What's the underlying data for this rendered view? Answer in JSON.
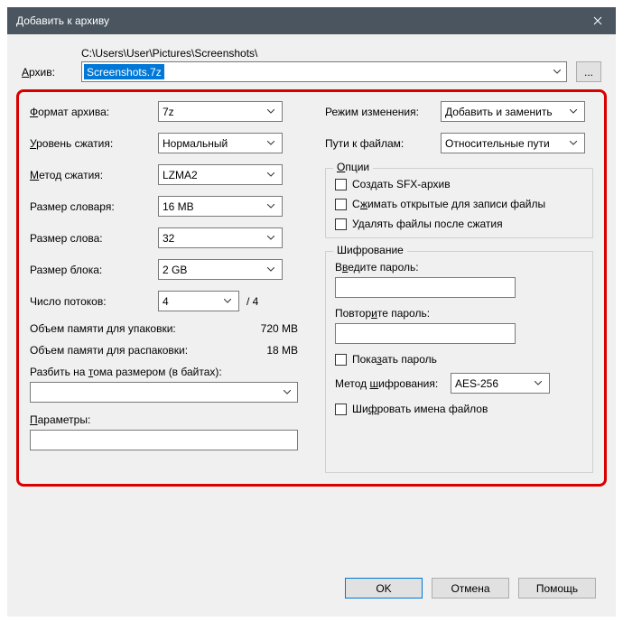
{
  "title": "Добавить к архиву",
  "archive": {
    "label": "Архив:",
    "path": "C:\\Users\\User\\Pictures\\Screenshots\\",
    "filename": "Screenshots.7z",
    "browse": "..."
  },
  "left": {
    "format": {
      "label": "Формат архива:",
      "accel": "Ф",
      "value": "7z"
    },
    "level": {
      "label": "Уровень сжатия:",
      "accel": "У",
      "value": "Нормальный"
    },
    "method": {
      "label": "Метод сжатия:",
      "accel": "М",
      "value": "LZMA2"
    },
    "dict": {
      "label": "Размер словаря:",
      "value": "16 MB"
    },
    "word": {
      "label": "Размер слова:",
      "value": "32"
    },
    "block": {
      "label": "Размер блока:",
      "value": "2 GB"
    },
    "threads": {
      "label": "Число потоков:",
      "value": "4",
      "max": "/ 4"
    },
    "mem_pack": {
      "label": "Объем памяти для упаковки:",
      "value": "720 MB"
    },
    "mem_unpack": {
      "label": "Объем памяти для распаковки:",
      "value": "18 MB"
    },
    "split": {
      "label": "Разбить на тома размером (в байтах):"
    },
    "params": {
      "label": "Параметры:"
    }
  },
  "right": {
    "mode": {
      "label": "Режим изменения:",
      "value": "Добавить и заменить"
    },
    "paths": {
      "label": "Пути к файлам:",
      "value": "Относительные пути"
    },
    "options": {
      "legend": "Опции",
      "sfx": "Создать SFX-архив",
      "shared": "Сжимать открытые для записи файлы",
      "delete": "Удалять файлы после сжатия"
    },
    "enc": {
      "legend": "Шифрование",
      "pwd": "Введите пароль:",
      "pwd2": "Повторите пароль:",
      "show": "Показать пароль",
      "method_label": "Метод шифрования:",
      "method_value": "AES-256",
      "names": "Шифровать имена файлов"
    }
  },
  "buttons": {
    "ok": "OK",
    "cancel": "Отмена",
    "help": "Помощь"
  }
}
